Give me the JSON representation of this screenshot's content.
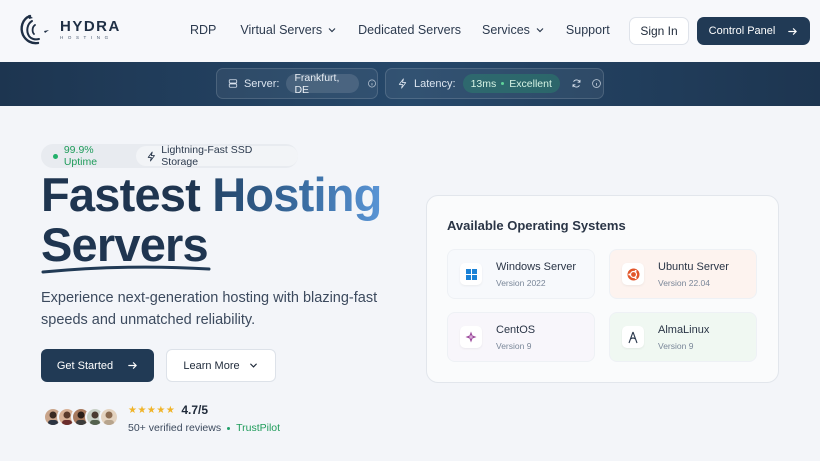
{
  "brand": {
    "name": "HYDRA",
    "tagline": "HOSTING"
  },
  "nav": [
    {
      "label": "RDP",
      "dropdown": false
    },
    {
      "label": "Virtual Servers",
      "dropdown": true
    },
    {
      "label": "Dedicated Servers",
      "dropdown": false
    },
    {
      "label": "Services",
      "dropdown": true
    },
    {
      "label": "Support",
      "dropdown": false
    }
  ],
  "header": {
    "signin_label": "Sign In",
    "control_panel_label": "Control Panel"
  },
  "status": {
    "server_label": "Server:",
    "server_value": "Frankfurt, DE",
    "latency_label": "Latency:",
    "latency_value": "13ms",
    "latency_quality": "Excellent"
  },
  "hero": {
    "uptime": "99.9% Uptime",
    "ssd": "Lightning-Fast SSD Storage",
    "title_line1_a": "Fastest ",
    "title_line1_b": "Hosting",
    "title_line2": "Servers",
    "subtitle": "Experience next-generation hosting with blazing-fast speeds and unmatched reliability.",
    "get_started_label": "Get Started",
    "learn_more_label": "Learn More"
  },
  "rating": {
    "stars": 5,
    "value": "4.7/5",
    "reviews": "50+ verified reviews",
    "source": "TrustPilot"
  },
  "os": {
    "title": "Available Operating Systems",
    "items": [
      {
        "name": "Windows Server",
        "version": "Version 2022",
        "icon": "windows-icon"
      },
      {
        "name": "Ubuntu Server",
        "version": "Version 22.04",
        "icon": "ubuntu-icon"
      },
      {
        "name": "CentOS",
        "version": "Version 9",
        "icon": "centos-icon"
      },
      {
        "name": "AlmaLinux",
        "version": "Version 9",
        "icon": "almalinux-icon"
      }
    ]
  },
  "colors": {
    "primary": "#213a55",
    "accent_green": "#22b06a",
    "star": "#f0b429"
  }
}
